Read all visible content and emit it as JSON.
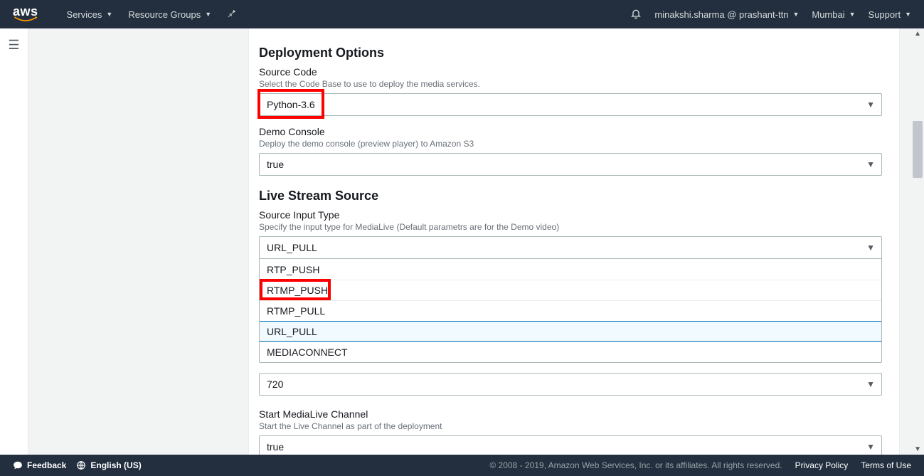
{
  "nav": {
    "logo_text": "aws",
    "services_label": "Services",
    "resource_groups_label": "Resource Groups",
    "user_label": "minakshi.sharma @ prashant-ttn",
    "region_label": "Mumbai",
    "support_label": "Support"
  },
  "form": {
    "deployment_heading": "Deployment Options",
    "source_code": {
      "label": "Source Code",
      "help": "Select the Code Base to use to deploy the media services.",
      "value": "Python-3.6"
    },
    "demo_console": {
      "label": "Demo Console",
      "help": "Deploy the demo console (preview player) to Amazon S3",
      "value": "true"
    },
    "live_stream_heading": "Live Stream Source",
    "source_input_type": {
      "label": "Source Input Type",
      "help": "Specify the input type for MediaLive (Default parametrs are for the Demo video)",
      "value": "URL_PULL",
      "options": [
        "RTP_PUSH",
        "RTMP_PUSH",
        "RTMP_PULL",
        "URL_PULL",
        "MEDIACONNECT"
      ]
    },
    "resolution": {
      "value": "720"
    },
    "start_channel": {
      "label": "Start MediaLive Channel",
      "help": "Start the Live Channel as part of the deployment",
      "value": "true"
    }
  },
  "footer": {
    "feedback_label": "Feedback",
    "language_label": "English (US)",
    "copyright": "© 2008 - 2019, Amazon Web Services, Inc. or its affiliates. All rights reserved.",
    "privacy_label": "Privacy Policy",
    "terms_label": "Terms of Use"
  }
}
